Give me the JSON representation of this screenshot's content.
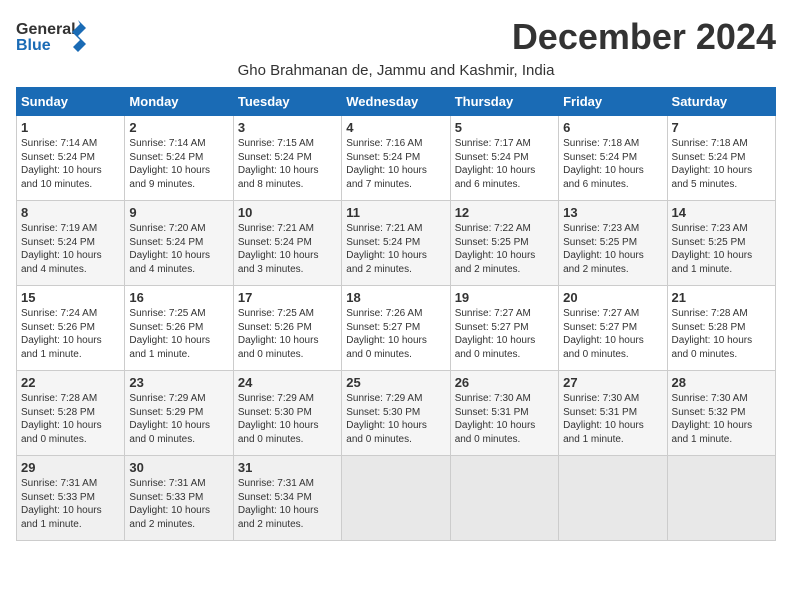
{
  "header": {
    "logo_general": "General",
    "logo_blue": "Blue",
    "month_title": "December 2024",
    "subtitle": "Gho Brahmanan de, Jammu and Kashmir, India"
  },
  "weekdays": [
    "Sunday",
    "Monday",
    "Tuesday",
    "Wednesday",
    "Thursday",
    "Friday",
    "Saturday"
  ],
  "weeks": [
    [
      {
        "day": "1",
        "sunrise": "7:14 AM",
        "sunset": "5:24 PM",
        "daylight": "10 hours and 10 minutes."
      },
      {
        "day": "2",
        "sunrise": "7:14 AM",
        "sunset": "5:24 PM",
        "daylight": "10 hours and 9 minutes."
      },
      {
        "day": "3",
        "sunrise": "7:15 AM",
        "sunset": "5:24 PM",
        "daylight": "10 hours and 8 minutes."
      },
      {
        "day": "4",
        "sunrise": "7:16 AM",
        "sunset": "5:24 PM",
        "daylight": "10 hours and 7 minutes."
      },
      {
        "day": "5",
        "sunrise": "7:17 AM",
        "sunset": "5:24 PM",
        "daylight": "10 hours and 6 minutes."
      },
      {
        "day": "6",
        "sunrise": "7:18 AM",
        "sunset": "5:24 PM",
        "daylight": "10 hours and 6 minutes."
      },
      {
        "day": "7",
        "sunrise": "7:18 AM",
        "sunset": "5:24 PM",
        "daylight": "10 hours and 5 minutes."
      }
    ],
    [
      {
        "day": "8",
        "sunrise": "7:19 AM",
        "sunset": "5:24 PM",
        "daylight": "10 hours and 4 minutes."
      },
      {
        "day": "9",
        "sunrise": "7:20 AM",
        "sunset": "5:24 PM",
        "daylight": "10 hours and 4 minutes."
      },
      {
        "day": "10",
        "sunrise": "7:21 AM",
        "sunset": "5:24 PM",
        "daylight": "10 hours and 3 minutes."
      },
      {
        "day": "11",
        "sunrise": "7:21 AM",
        "sunset": "5:24 PM",
        "daylight": "10 hours and 2 minutes."
      },
      {
        "day": "12",
        "sunrise": "7:22 AM",
        "sunset": "5:25 PM",
        "daylight": "10 hours and 2 minutes."
      },
      {
        "day": "13",
        "sunrise": "7:23 AM",
        "sunset": "5:25 PM",
        "daylight": "10 hours and 2 minutes."
      },
      {
        "day": "14",
        "sunrise": "7:23 AM",
        "sunset": "5:25 PM",
        "daylight": "10 hours and 1 minute."
      }
    ],
    [
      {
        "day": "15",
        "sunrise": "7:24 AM",
        "sunset": "5:26 PM",
        "daylight": "10 hours and 1 minute."
      },
      {
        "day": "16",
        "sunrise": "7:25 AM",
        "sunset": "5:26 PM",
        "daylight": "10 hours and 1 minute."
      },
      {
        "day": "17",
        "sunrise": "7:25 AM",
        "sunset": "5:26 PM",
        "daylight": "10 hours and 0 minutes."
      },
      {
        "day": "18",
        "sunrise": "7:26 AM",
        "sunset": "5:27 PM",
        "daylight": "10 hours and 0 minutes."
      },
      {
        "day": "19",
        "sunrise": "7:27 AM",
        "sunset": "5:27 PM",
        "daylight": "10 hours and 0 minutes."
      },
      {
        "day": "20",
        "sunrise": "7:27 AM",
        "sunset": "5:27 PM",
        "daylight": "10 hours and 0 minutes."
      },
      {
        "day": "21",
        "sunrise": "7:28 AM",
        "sunset": "5:28 PM",
        "daylight": "10 hours and 0 minutes."
      }
    ],
    [
      {
        "day": "22",
        "sunrise": "7:28 AM",
        "sunset": "5:28 PM",
        "daylight": "10 hours and 0 minutes."
      },
      {
        "day": "23",
        "sunrise": "7:29 AM",
        "sunset": "5:29 PM",
        "daylight": "10 hours and 0 minutes."
      },
      {
        "day": "24",
        "sunrise": "7:29 AM",
        "sunset": "5:30 PM",
        "daylight": "10 hours and 0 minutes."
      },
      {
        "day": "25",
        "sunrise": "7:29 AM",
        "sunset": "5:30 PM",
        "daylight": "10 hours and 0 minutes."
      },
      {
        "day": "26",
        "sunrise": "7:30 AM",
        "sunset": "5:31 PM",
        "daylight": "10 hours and 0 minutes."
      },
      {
        "day": "27",
        "sunrise": "7:30 AM",
        "sunset": "5:31 PM",
        "daylight": "10 hours and 1 minute."
      },
      {
        "day": "28",
        "sunrise": "7:30 AM",
        "sunset": "5:32 PM",
        "daylight": "10 hours and 1 minute."
      }
    ],
    [
      {
        "day": "29",
        "sunrise": "7:31 AM",
        "sunset": "5:33 PM",
        "daylight": "10 hours and 1 minute."
      },
      {
        "day": "30",
        "sunrise": "7:31 AM",
        "sunset": "5:33 PM",
        "daylight": "10 hours and 2 minutes."
      },
      {
        "day": "31",
        "sunrise": "7:31 AM",
        "sunset": "5:34 PM",
        "daylight": "10 hours and 2 minutes."
      },
      null,
      null,
      null,
      null
    ]
  ]
}
